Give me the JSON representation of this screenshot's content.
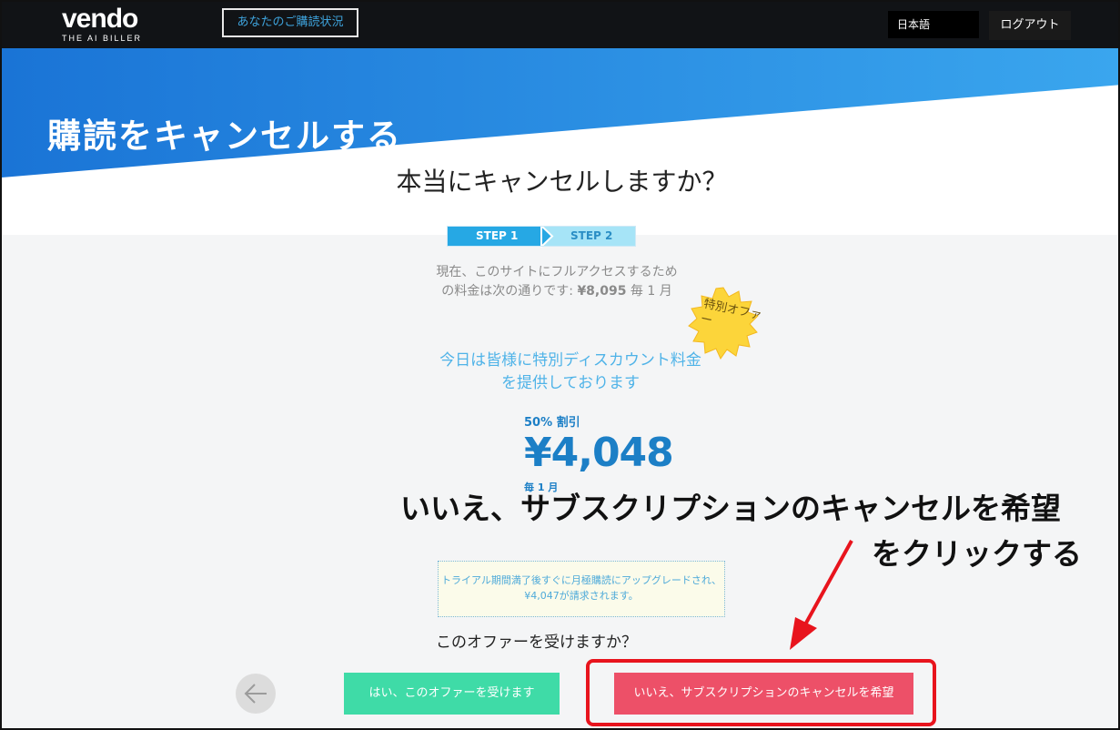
{
  "header": {
    "logo": {
      "wordmark": "vendo",
      "tagline": "THE AI BILLER"
    },
    "subscription_status_label": "あなたのご購読状況",
    "language": "日本語",
    "logout_label": "ログアウト"
  },
  "hero": {
    "title": "購読をキャンセルする"
  },
  "main": {
    "question": "本当にキャンセルしますか？",
    "steps": [
      "STEP 1",
      "STEP 2"
    ],
    "current_price_line1": "現在、このサイトにフルアクセスするため",
    "current_price_line2_prefix": "の料金は次の通りです: ",
    "current_price_amount": "¥8,095",
    "current_price_suffix": " 毎 1 月",
    "badge_text": "特別オファー",
    "discount_line1": "今日は皆様に特別ディスカウント料金",
    "discount_line2": "を提供しております",
    "discount_label": "50% 割引",
    "discount_price": "¥4,048",
    "per_month": "毎 1 月",
    "trial_info": "トライアル期間満了後すぐに月極購読にアップグレードされ、¥4,047が請求されます。",
    "accept_question": "このオファーを受けますか？",
    "yes_button": "はい、このオファーを受けます",
    "no_button": "いいえ、サブスクリプションのキャンセルを希望"
  },
  "annotation": {
    "line1": "いいえ、サブスクリプションのキャンセルを希望",
    "line2": "をクリックする"
  },
  "colors": {
    "accent_blue": "#1c7fc6",
    "hero_blue": "#2a8fe0",
    "yes_green": "#3fdba7",
    "no_red": "#ed5068",
    "highlight_red": "#e8141d"
  }
}
